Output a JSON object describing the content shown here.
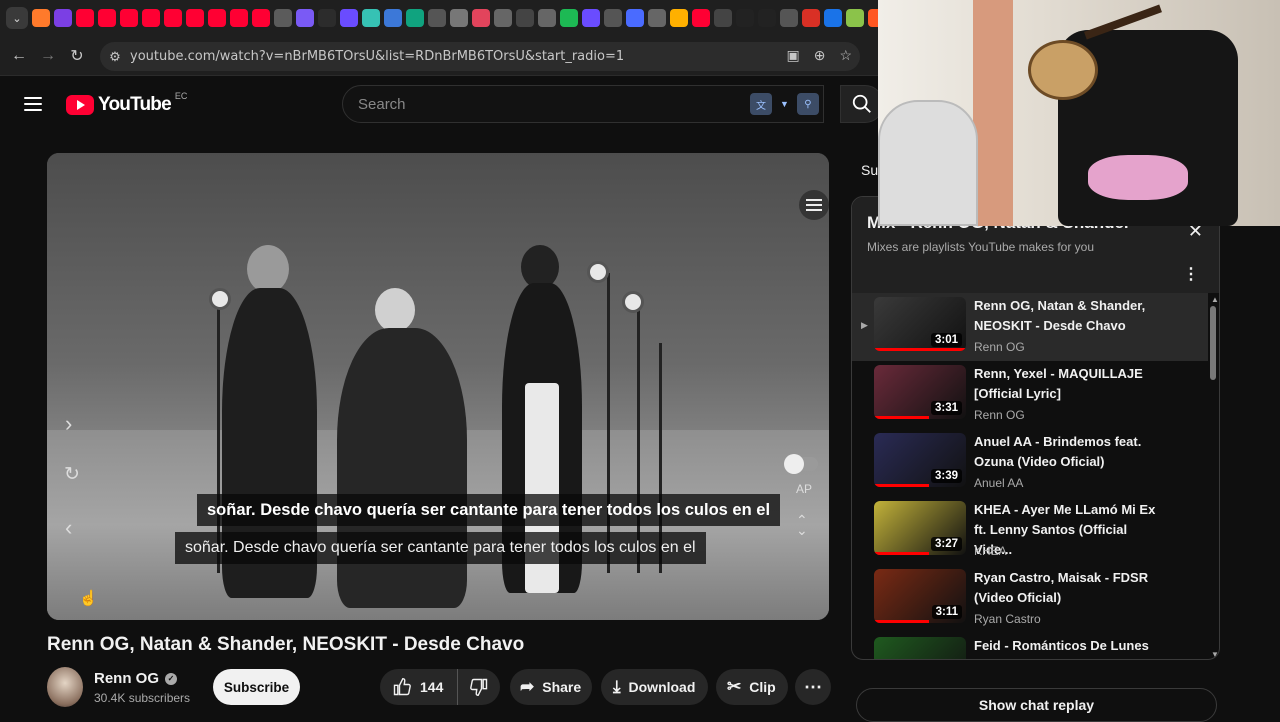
{
  "browser": {
    "url": "youtube.com/watch?v=nBrMB6TOrsU&list=RDnBrMB6TOrsU&start_radio=1",
    "favicons": [
      {
        "name": "chevron-down-icon",
        "color": "#3a3a3a"
      },
      {
        "name": "orange-icon",
        "color": "#ff7a2b"
      },
      {
        "name": "purple-icon",
        "color": "#7b3fe4"
      },
      {
        "name": "youtube-icon",
        "color": "#ff0033"
      },
      {
        "name": "youtube-icon",
        "color": "#ff0033"
      },
      {
        "name": "youtube-icon",
        "color": "#ff0033"
      },
      {
        "name": "youtube-icon",
        "color": "#ff0033"
      },
      {
        "name": "youtube-icon",
        "color": "#ff0033"
      },
      {
        "name": "youtube-icon",
        "color": "#ff0033"
      },
      {
        "name": "youtube-icon",
        "color": "#ff0033"
      },
      {
        "name": "youtube-icon",
        "color": "#ff0033"
      },
      {
        "name": "youtube-icon",
        "color": "#ff0033"
      },
      {
        "name": "translate-icon",
        "color": "#5b5b5b"
      },
      {
        "name": "b-icon",
        "color": "#7a5af5"
      },
      {
        "name": "dark-icon",
        "color": "#2c2c2c"
      },
      {
        "name": "s-icon",
        "color": "#6a4cff"
      },
      {
        "name": "p-icon",
        "color": "#36c2b4"
      },
      {
        "name": "clock-icon",
        "color": "#3c78d8"
      },
      {
        "name": "chatgpt-icon",
        "color": "#10a37f"
      },
      {
        "name": "notion-icon",
        "color": "#555555"
      },
      {
        "name": "w-icon",
        "color": "#777777"
      },
      {
        "name": "pin-icon",
        "color": "#e2445c"
      },
      {
        "name": "diamond-icon",
        "color": "#666666"
      },
      {
        "name": "x-icon",
        "color": "#444444"
      },
      {
        "name": "diamond-icon",
        "color": "#666666"
      },
      {
        "name": "check-icon",
        "color": "#1db954"
      },
      {
        "name": "s-icon",
        "color": "#6a4cff"
      },
      {
        "name": "p-icon",
        "color": "#555555"
      },
      {
        "name": "bars-icon",
        "color": "#4a6bff"
      },
      {
        "name": "ghost-icon",
        "color": "#666666"
      },
      {
        "name": "chat-icon",
        "color": "#ffb000"
      },
      {
        "name": "youtube-icon",
        "color": "#ff0033"
      },
      {
        "name": "compass-icon",
        "color": "#444444"
      },
      {
        "name": "tiktok-icon",
        "color": "#222222"
      },
      {
        "name": "tiktok-icon",
        "color": "#222222"
      },
      {
        "name": "notion-icon",
        "color": "#555555"
      },
      {
        "name": "red-circle-icon",
        "color": "#d93025"
      },
      {
        "name": "lightning-icon",
        "color": "#1a73e8"
      },
      {
        "name": "android-icon",
        "color": "#8bc34a"
      },
      {
        "name": "orange-square-icon",
        "color": "#ff5722"
      }
    ]
  },
  "yt": {
    "logo_text": "YouTube",
    "region": "EC",
    "search_placeholder": "Search"
  },
  "player": {
    "caption_top": "soñar. Desde chavo quería ser cantante para tener todos los culos en el",
    "caption_bottom": "soñar. Desde chavo quería ser cantante para tener todos los culos en el",
    "autoplay_label": "AP"
  },
  "video": {
    "title": "Renn OG, Natan & Shander, NEOSKIT - Desde Chavo",
    "channel": "Renn  OG",
    "subscribers": "30.4K subscribers",
    "subscribe_label": "Subscribe",
    "likes": "144",
    "share_label": "Share",
    "download_label": "Download",
    "clip_label": "Clip"
  },
  "sidebar": {
    "tab_label": "Sub"
  },
  "playlist": {
    "title": "Mix - Renn OG, Natan & Shander",
    "subtitle": "Mixes are playlists YouTube makes for you",
    "items": [
      {
        "title": "Renn OG, Natan & Shander, NEOSKIT - Desde Chavo",
        "channel": "Renn OG",
        "duration": "3:01",
        "thumb": "#3a3a3a"
      },
      {
        "title": "Renn, Yexel - MAQUILLAJE [Official Lyric]",
        "channel": "Renn OG",
        "duration": "3:31",
        "thumb": "#6a2a3a"
      },
      {
        "title": "Anuel AA - Brindemos feat. Ozuna (Video Oficial)",
        "channel": "Anuel AA",
        "duration": "3:39",
        "thumb": "#2a2b55"
      },
      {
        "title": "KHEA - Ayer Me LLamó Mi Ex ft. Lenny Santos (Official Vide...",
        "channel": "KHEA",
        "duration": "3:27",
        "thumb": "#c2b23a"
      },
      {
        "title": "Ryan Castro, Maisak - FDSR (Video Oficial)",
        "channel": "Ryan Castro",
        "duration": "3:11",
        "thumb": "#7a2a14"
      },
      {
        "title": "Feid - Románticos De Lunes",
        "channel": "",
        "duration": "",
        "thumb": "#1f5a1f"
      }
    ]
  },
  "chat_replay_label": "Show chat replay"
}
